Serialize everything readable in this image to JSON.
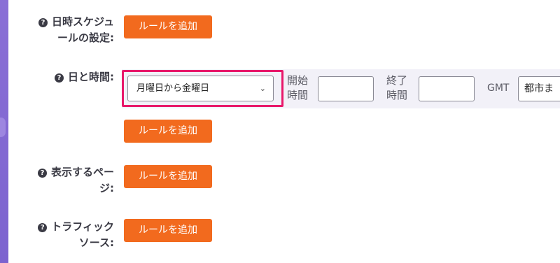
{
  "sections": {
    "schedule": {
      "label_line1": "日時スケジュ",
      "label_line2": "ールの設定:",
      "add_button": "ルールを追加"
    },
    "day_time": {
      "label": "日と時間:",
      "day_select_value": "月曜日から金曜日",
      "start_label_line1": "開始",
      "start_label_line2": "時間",
      "start_time_value": "",
      "end_label_line1": "終了",
      "end_label_line2": "時間",
      "end_time_value": "",
      "timezone_label": "GMT",
      "city_select_value": "都市ま",
      "add_button": "ルールを追加"
    },
    "pages": {
      "label_line1": "表示するペー",
      "label_line2": "ジ:",
      "add_button": "ルールを追加"
    },
    "traffic": {
      "label_line1": "トラフィック",
      "label_line2": "ソース:",
      "add_button": "ルールを追加"
    }
  },
  "icons": {
    "help": "help-circle-icon",
    "dropdown": "chevron-down-icon"
  },
  "colors": {
    "button": "#f26a1e",
    "highlight": "#e8186a",
    "sidebar": "#7c63cf",
    "row_background": "#f2f1f8"
  }
}
